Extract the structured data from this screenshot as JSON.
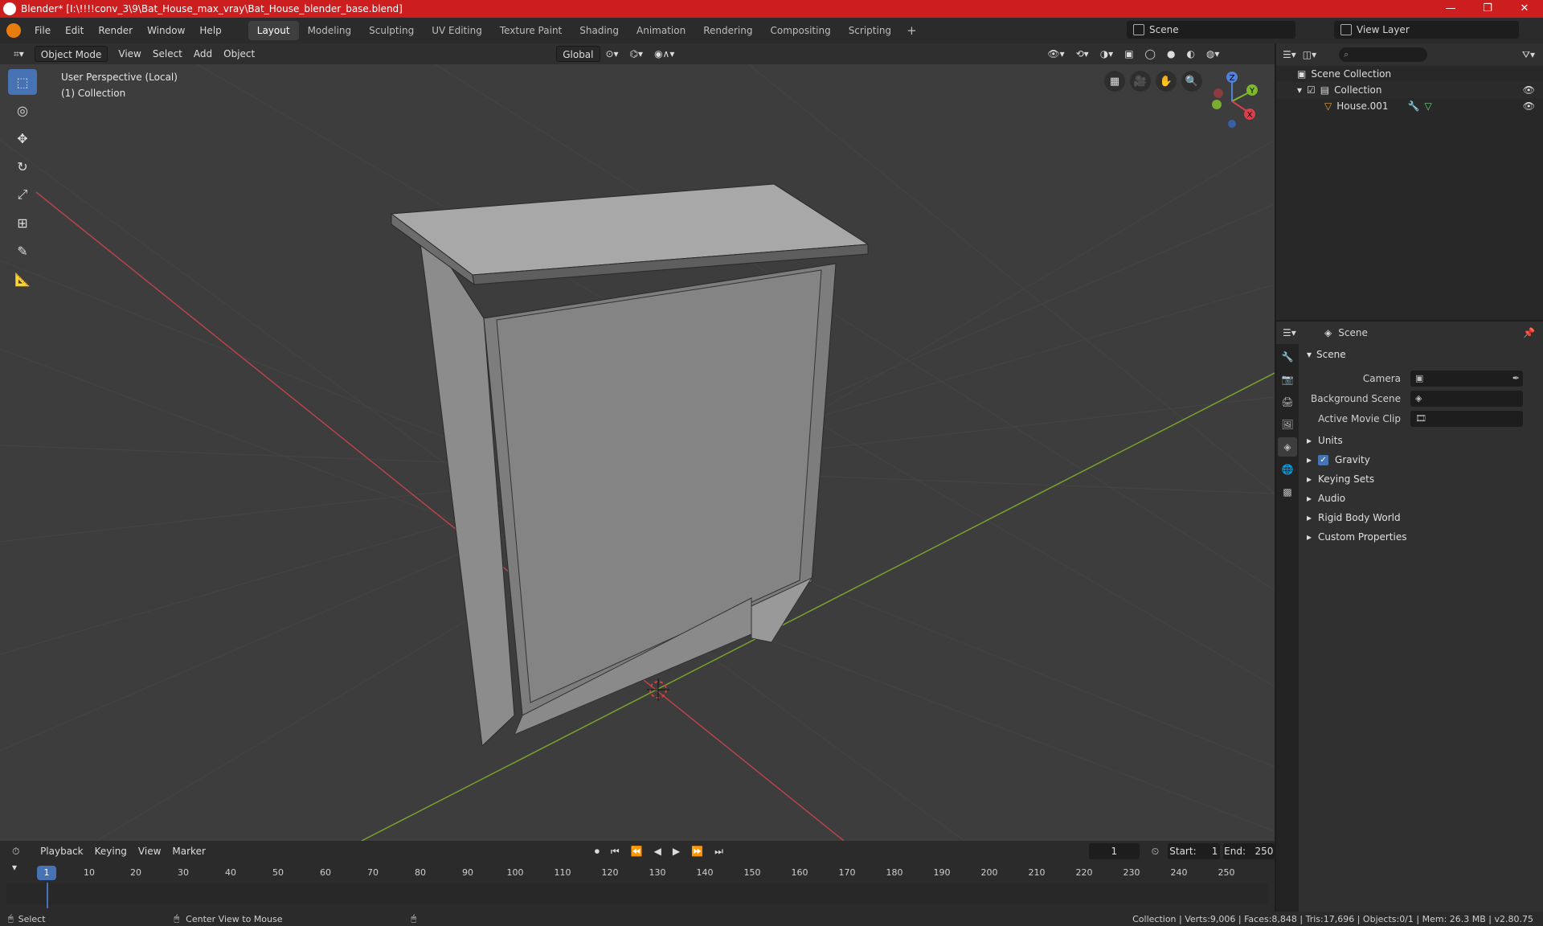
{
  "window": {
    "title": "Blender* [I:\\!!!!conv_3\\9\\Bat_House_max_vray\\Bat_House_blender_base.blend]",
    "minimize": "—",
    "maximize": "❐",
    "close": "✕"
  },
  "menu": [
    "File",
    "Edit",
    "Render",
    "Window",
    "Help"
  ],
  "workspaces": [
    "Layout",
    "Modeling",
    "Sculpting",
    "UV Editing",
    "Texture Paint",
    "Shading",
    "Animation",
    "Rendering",
    "Compositing",
    "Scripting"
  ],
  "workspace_add": "+",
  "scene_selector": "Scene",
  "view_layer_selector": "View Layer",
  "viewport": {
    "mode": "Object Mode",
    "menus": [
      "View",
      "Select",
      "Add",
      "Object"
    ],
    "transform_orientation": "Global",
    "info_line1": "User Perspective (Local)",
    "info_line2": "(1) Collection",
    "gizmo": {
      "z": "Z",
      "y": "Y",
      "x": "X"
    }
  },
  "outliner": {
    "search_placeholder": "",
    "rows": [
      {
        "label": "Scene Collection"
      },
      {
        "label": "Collection"
      },
      {
        "label": "House.001"
      }
    ]
  },
  "properties": {
    "header": "Scene",
    "panel_title": "Scene",
    "fields": [
      {
        "label": "Camera",
        "value": ""
      },
      {
        "label": "Background Scene",
        "value": ""
      },
      {
        "label": "Active Movie Clip",
        "value": ""
      }
    ],
    "subpanels": [
      "Units",
      "Gravity",
      "Keying Sets",
      "Audio",
      "Rigid Body World",
      "Custom Properties"
    ],
    "gravity_checked": true
  },
  "timeline": {
    "menus": [
      "Playback",
      "Keying",
      "View",
      "Marker"
    ],
    "current_frame": "1",
    "start_label": "Start:",
    "start": "1",
    "end_label": "End:",
    "end": "250",
    "ruler": [
      "10",
      "20",
      "30",
      "40",
      "50",
      "60",
      "70",
      "80",
      "90",
      "100",
      "110",
      "120",
      "130",
      "140",
      "150",
      "160",
      "170",
      "180",
      "190",
      "200",
      "210",
      "220",
      "230",
      "240",
      "250"
    ],
    "ruler_current": "1"
  },
  "statusbar": {
    "left": "Select",
    "middle": "Center View to Mouse",
    "right": "Collection | Verts:9,006 | Faces:8,848 | Tris:17,696 | Objects:0/1 | Mem: 26.3 MB | v2.80.75"
  }
}
